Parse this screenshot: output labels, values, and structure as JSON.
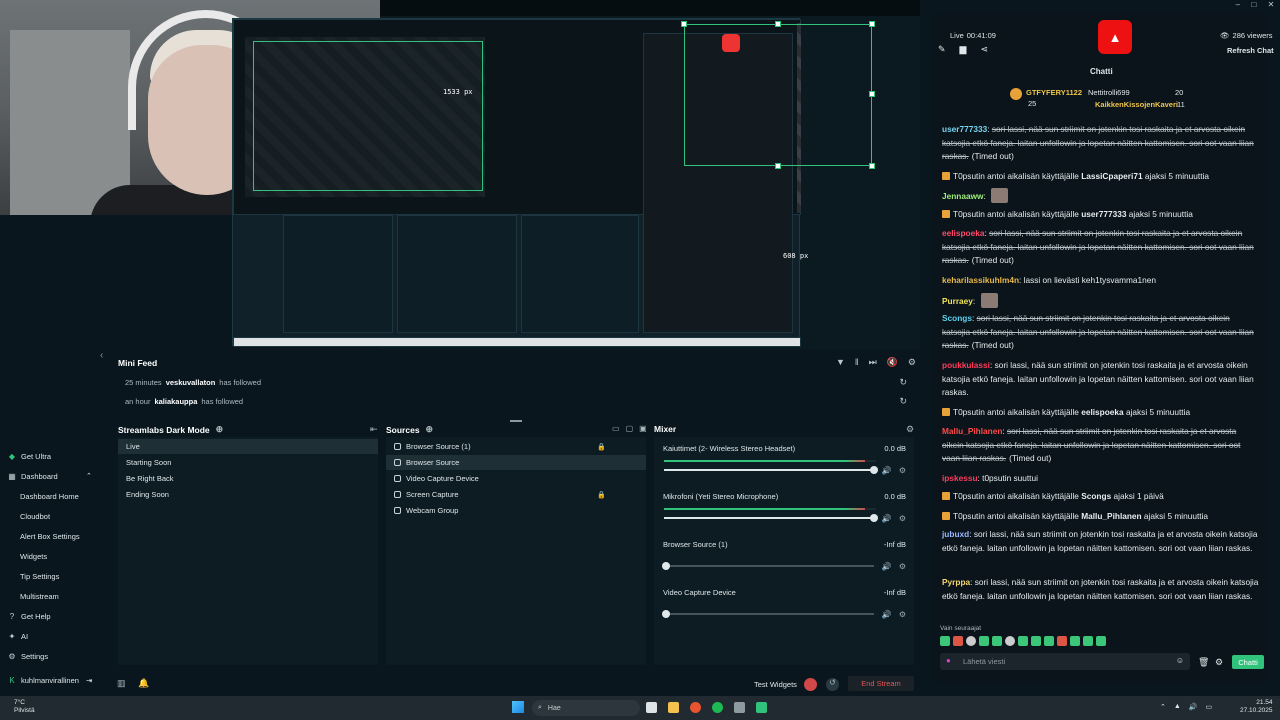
{
  "window_controls": [
    "–",
    "□",
    "✕"
  ],
  "preview": {
    "dim_w": "1533 px",
    "dim_h": "608 px"
  },
  "mini_feed": {
    "title": "Mini Feed",
    "rows": [
      {
        "time": "25 minutes",
        "user": "veskuvallaton",
        "action": "has followed"
      },
      {
        "time": "an hour",
        "user": "kaliakauppa",
        "action": "has followed"
      }
    ]
  },
  "scenes": {
    "title": "Streamlabs Dark Mode",
    "items": [
      "Live",
      "Starting Soon",
      "Be Right Back",
      "Ending Soon"
    ]
  },
  "sources": {
    "title": "Sources",
    "items": [
      "Browser Source (1)",
      "Browser Source",
      "Video Capture Device",
      "Screen Capture",
      "Webcam Group"
    ]
  },
  "mixer": {
    "title": "Mixer",
    "channels": [
      {
        "name": "Kaiuttimet (2- Wireless Stereo Headset)",
        "db": "0.0 dB",
        "level": 0.95
      },
      {
        "name": "Mikrofoni (Yeti Stereo Microphone)",
        "db": "0.0 dB",
        "level": 0.95
      },
      {
        "name": "Browser Source (1)",
        "db": "-Inf dB",
        "level": 0.0
      },
      {
        "name": "Video Capture Device",
        "db": "-Inf dB",
        "level": 0.0
      }
    ]
  },
  "left_nav": {
    "get_ultra": "Get Ultra",
    "dashboard": "Dashboard",
    "sub_items": [
      "Dashboard Home",
      "Cloudbot",
      "Alert Box Settings",
      "Widgets",
      "Tip Settings",
      "Multistream"
    ],
    "get_help": "Get Help",
    "ai": "AI",
    "settings": "Settings",
    "username": "kuhlmanvirallinen"
  },
  "bottom": {
    "test_widgets": "Test Widgets",
    "end_stream": "End Stream"
  },
  "chat": {
    "live_label": "Live",
    "live_time": "00:41:09",
    "viewers": "286 viewers",
    "refresh": "Refresh Chat",
    "title": "Chatti",
    "top1_name": "GTFYFERY1122",
    "top1_count": "25",
    "top2_name": "Nettitrolli699",
    "top2_count": "20",
    "top3_name": "KaikkenKissojenKaveri",
    "top3_count": "11",
    "messages": [
      {
        "user": "user777333",
        "text": "sori lassi, nää sun striimit on jotenkin tosi raskaita ja et arvosta oikein katsojia etkö faneja. laitan unfollowin ja lopetan näitten kattomisen. sori oot vaan liian raskas.",
        "suffix": "(Timed out)",
        "color": "#7ad3f0",
        "strike": true
      },
      {
        "mod": true,
        "text": "T0psutin antoi aikalisän käyttäjälle ",
        "bold": "LassiCpaperi71",
        "tail": " ajaksi 5 minuuttia"
      },
      {
        "user": "Jennaaww",
        "text": "",
        "color": "#9ef07a",
        "emote": true
      },
      {
        "mod": true,
        "text": "T0psutin antoi aikalisän käyttäjälle ",
        "bold": "user777333",
        "tail": " ajaksi 5 minuuttia"
      },
      {
        "user": "eelispoeka",
        "text": "sori lassi, nää sun striimit on jotenkin tosi raskaita ja et arvosta oikein katsojia etkö faneja. laitan unfollowin ja lopetan näitten kattomisen. sori oot vaan liian raskas.",
        "suffix": "(Timed out)",
        "color": "#ff4a6b",
        "strike": true
      },
      {
        "user": "keharilassikuhlm4n",
        "text": "lassi on lievästi keh1tysvamma1nen",
        "color": "#e8b84a"
      },
      {
        "user": "Purraey",
        "text": "",
        "color": "#f2e35a",
        "emote": true
      },
      {
        "user": "Scongs",
        "text": "sori lassi, nää sun striimit on jotenkin tosi raskaita ja et arvosta oikein katsojia etkö faneja. laitan unfollowin ja lopetan näitten kattomisen. sori oot vaan liian raskas.",
        "suffix": "(Timed out)",
        "color": "#5ad2f0",
        "strike": true
      },
      {
        "user": "poukkulassi",
        "text": "sori lassi, nää sun striimit on jotenkin tosi raskaita ja et arvosta oikein katsojia etkö faneja. laitan unfollowin ja lopetan näitten kattomisen. sori oot vaan liian raskas.",
        "color": "#ff3b5c"
      },
      {
        "mod": true,
        "text": "T0psutin antoi aikalisän käyttäjälle ",
        "bold": "eelispoeka",
        "tail": " ajaksi 5 minuuttia"
      },
      {
        "user": "Mallu_Pihlanen",
        "text": "sori lassi, nää sun striimit on jotenkin tosi raskaita ja et arvosta oikein katsojia etkö faneja. laitan unfollowin ja lopetan näitten kattomisen. sori oot vaan liian raskas.",
        "suffix": "(Timed out)",
        "color": "#ff4a4a",
        "strike": true
      },
      {
        "user": "ipskessu",
        "text": "t0psutin suuttui",
        "color": "#ff3b5c"
      },
      {
        "mod": true,
        "text": "T0psutin antoi aikalisän käyttäjälle ",
        "bold": "Scongs",
        "tail": " ajaksi 1 päivä"
      },
      {
        "mod": true,
        "text": "T0psutin antoi aikalisän käyttäjälle ",
        "bold": "Mallu_Pihlanen",
        "tail": " ajaksi 5 minuuttia"
      },
      {
        "user": "jubuxd",
        "text": "sori lassi, nää sun striimit on jotenkin tosi raskaita ja et arvosta oikein katsojia etkö faneja. laitan unfollowin ja lopetan näitten kattomisen. sori oot vaan liian raskas.",
        "color": "#9ab8ff"
      },
      {
        "user": "Pyrppa",
        "text": "sori lassi, nää sun striimit on jotenkin tosi raskaita ja et arvosta oikein katsojia etkö faneja. laitan unfollowin ja lopetan näitten kattomisen. sori oot vaan liian raskas.",
        "color": "#f5d76e"
      }
    ],
    "followers_only": "Vain seuraajat",
    "input_placeholder": "Lähetä viesti",
    "send_button": "Chatti"
  },
  "taskbar": {
    "weather_temp": "7°C",
    "weather_desc": "Pilvistä",
    "search_placeholder": "Hae",
    "time": "21.54",
    "date": "27.10.2025"
  }
}
